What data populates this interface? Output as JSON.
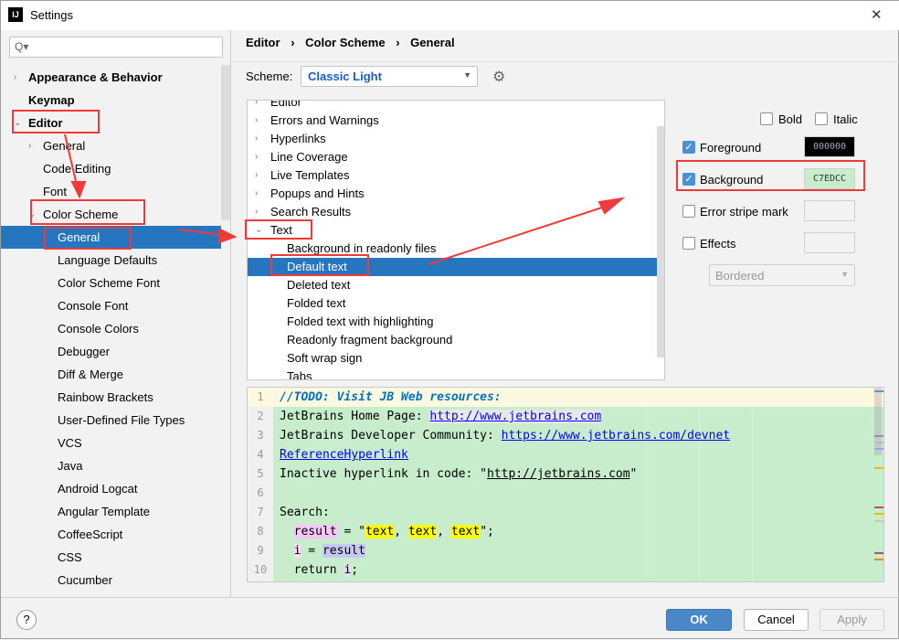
{
  "window": {
    "title": "Settings",
    "close": "✕"
  },
  "search": {
    "placeholder": "Q▾"
  },
  "sidebar": {
    "items": [
      {
        "label": "Appearance & Behavior",
        "bold": true,
        "chev": "›"
      },
      {
        "label": "Keymap",
        "bold": true
      },
      {
        "label": "Editor",
        "bold": true,
        "chev": "⌄"
      },
      {
        "label": "General",
        "chev": "›"
      },
      {
        "label": "Code Editing"
      },
      {
        "label": "Font"
      },
      {
        "label": "Color Scheme",
        "chev": "⌄"
      },
      {
        "label": "General",
        "selected": true
      },
      {
        "label": "Language Defaults"
      },
      {
        "label": "Color Scheme Font"
      },
      {
        "label": "Console Font"
      },
      {
        "label": "Console Colors"
      },
      {
        "label": "Debugger"
      },
      {
        "label": "Diff & Merge"
      },
      {
        "label": "Rainbow Brackets"
      },
      {
        "label": "User-Defined File Types"
      },
      {
        "label": "VCS"
      },
      {
        "label": "Java"
      },
      {
        "label": "Android Logcat"
      },
      {
        "label": "Angular Template"
      },
      {
        "label": "CoffeeScript"
      },
      {
        "label": "CSS"
      },
      {
        "label": "Cucumber"
      }
    ]
  },
  "breadcrumb": [
    "Editor",
    "Color Scheme",
    "General"
  ],
  "scheme": {
    "label": "Scheme:",
    "value": "Classic Light"
  },
  "attr_tree": [
    {
      "label": "Editor",
      "chev": "›"
    },
    {
      "label": "Errors and Warnings",
      "chev": "›"
    },
    {
      "label": "Hyperlinks",
      "chev": "›"
    },
    {
      "label": "Line Coverage",
      "chev": "›"
    },
    {
      "label": "Live Templates",
      "chev": "›"
    },
    {
      "label": "Popups and Hints",
      "chev": "›"
    },
    {
      "label": "Search Results",
      "chev": "›"
    },
    {
      "label": "Text",
      "chev": "⌄"
    },
    {
      "label": "Background in readonly files",
      "child": true
    },
    {
      "label": "Default text",
      "child": true,
      "selected": true
    },
    {
      "label": "Deleted text",
      "child": true
    },
    {
      "label": "Folded text",
      "child": true
    },
    {
      "label": "Folded text with highlighting",
      "child": true
    },
    {
      "label": "Readonly fragment background",
      "child": true
    },
    {
      "label": "Soft wrap sign",
      "child": true
    },
    {
      "label": "Tabs",
      "child": true
    }
  ],
  "props": {
    "bold": "Bold",
    "italic": "Italic",
    "foreground": {
      "label": "Foreground",
      "checked": true,
      "value": "000000"
    },
    "background": {
      "label": "Background",
      "checked": true,
      "value": "C7EDCC"
    },
    "error_stripe": {
      "label": "Error stripe mark",
      "checked": false
    },
    "effects": {
      "label": "Effects",
      "checked": false
    },
    "effect_type": "Bordered"
  },
  "preview": {
    "lines": [
      "1",
      "2",
      "3",
      "4",
      "5",
      "6",
      "7",
      "8",
      "9",
      "10"
    ],
    "todo": "//TODO: Visit JB Web resources:",
    "l2a": "JetBrains Home Page: ",
    "l2b": "http://www.jetbrains.com",
    "l3a": "JetBrains Developer Community: ",
    "l3b": "https://www.jetbrains.com/devnet",
    "l4": "ReferenceHyperlink",
    "l5a": "Inactive hyperlink in code: \"",
    "l5b": "http://jetbrains.com",
    "l5c": "\"",
    "l7": "Search:",
    "l8a": "result",
    "l8b": " = \"",
    "l8c": "text",
    ", ": ", ",
    "l8d": "\";",
    "l9a": "i",
    "l9b": " = ",
    "l9c": "result",
    "l10a": "return ",
    "l10b": "i",
    ";": ";"
  },
  "buttons": {
    "ok": "OK",
    "cancel": "Cancel",
    "apply": "Apply",
    "help": "?"
  },
  "colors": {
    "accent": "#2675bf",
    "background": "#C7EDCC",
    "annotation": "#f03a3a"
  }
}
